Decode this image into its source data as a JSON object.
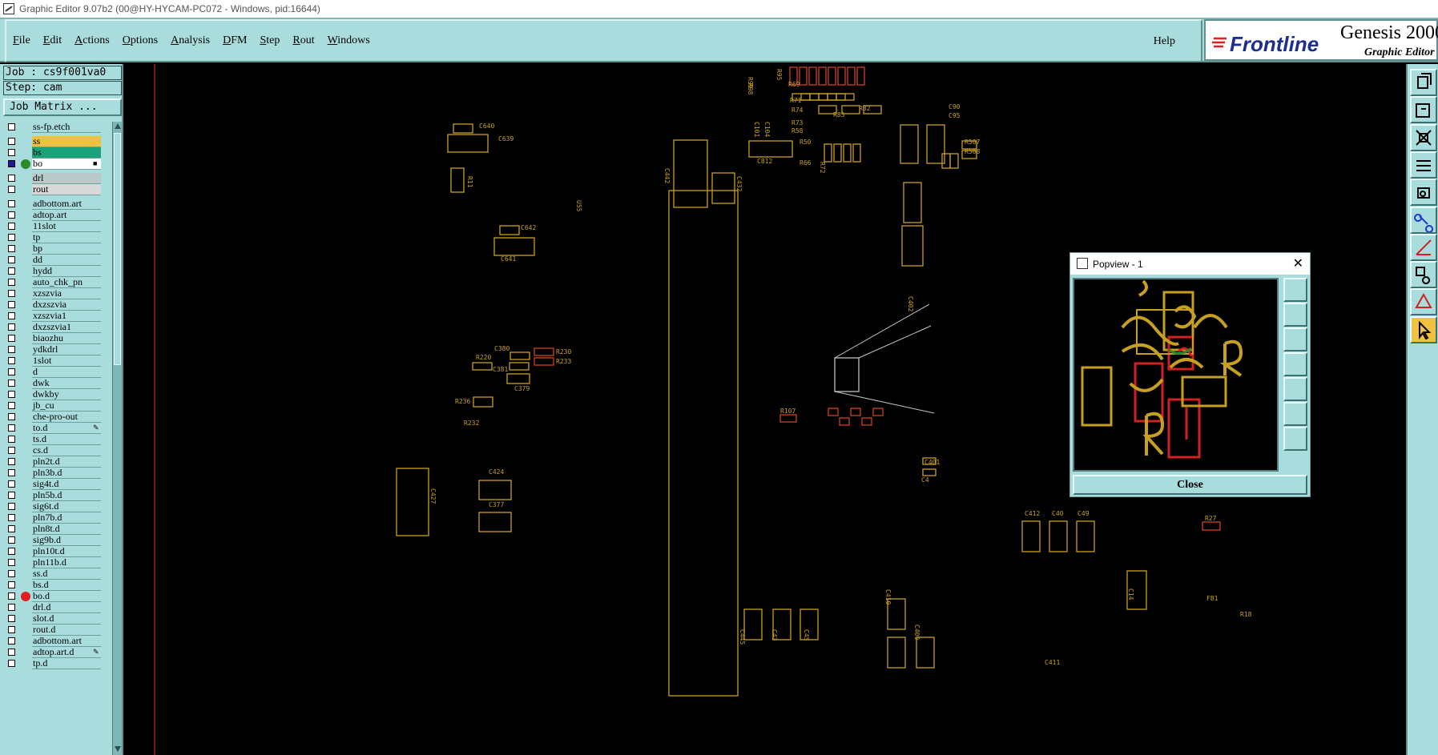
{
  "window": {
    "title": "Graphic Editor 9.07b2 (00@HY-HYCAM-PC072 - Windows, pid:16644)"
  },
  "menubar": {
    "items": [
      "File",
      "Edit",
      "Actions",
      "Options",
      "Analysis",
      "DFM",
      "Step",
      "Rout",
      "Windows"
    ],
    "help": "Help"
  },
  "brand": {
    "logo": "Frontline",
    "product": "Genesis 2000",
    "subtitle": "Graphic Editor"
  },
  "job": {
    "job_label": "Job : cs9f001va0",
    "step_label": "Step: cam",
    "matrix_button": "Job Matrix ..."
  },
  "colors": {
    "panel": "#a9dcdc",
    "layer_ss": "#f0c040",
    "layer_bs": "#1aa37a",
    "trace": "#c8a020",
    "pad_red": "#d04020"
  },
  "layers": [
    {
      "name": "ss-fp.etch",
      "bg": "#a9dcdc",
      "checked": false
    },
    {
      "name": "ss",
      "bg": "#f0c040",
      "checked": false
    },
    {
      "name": "bs",
      "bg": "#1aa37a",
      "checked": false
    },
    {
      "name": "bo",
      "bg": "#ffffff",
      "checked": true,
      "mark": "#2a8a2a",
      "ext": "■"
    },
    {
      "name": "drl",
      "bg": "#b9c9c9",
      "checked": false
    },
    {
      "name": "rout",
      "bg": "#d9d9d9",
      "checked": false
    },
    {
      "name": "adbottom.art",
      "bg": "#a9dcdc",
      "checked": false
    },
    {
      "name": "adtop.art",
      "bg": "#a9dcdc",
      "checked": false
    },
    {
      "name": "11slot",
      "bg": "#a9dcdc",
      "checked": false
    },
    {
      "name": "tp",
      "bg": "#a9dcdc",
      "checked": false
    },
    {
      "name": "bp",
      "bg": "#a9dcdc",
      "checked": false
    },
    {
      "name": "dd",
      "bg": "#a9dcdc",
      "checked": false
    },
    {
      "name": "hydd",
      "bg": "#a9dcdc",
      "checked": false
    },
    {
      "name": "auto_chk_pn",
      "bg": "#a9dcdc",
      "checked": false
    },
    {
      "name": "xzszvia",
      "bg": "#a9dcdc",
      "checked": false
    },
    {
      "name": "dxzszvia",
      "bg": "#a9dcdc",
      "checked": false
    },
    {
      "name": "xzszvia1",
      "bg": "#a9dcdc",
      "checked": false
    },
    {
      "name": "dxzszvia1",
      "bg": "#a9dcdc",
      "checked": false
    },
    {
      "name": "biaozhu",
      "bg": "#a9dcdc",
      "checked": false
    },
    {
      "name": "ydkdrl",
      "bg": "#a9dcdc",
      "checked": false
    },
    {
      "name": "1slot",
      "bg": "#a9dcdc",
      "checked": false
    },
    {
      "name": "d",
      "bg": "#a9dcdc",
      "checked": false
    },
    {
      "name": "dwk",
      "bg": "#a9dcdc",
      "checked": false
    },
    {
      "name": "dwkby",
      "bg": "#a9dcdc",
      "checked": false
    },
    {
      "name": "jb_cu",
      "bg": "#a9dcdc",
      "checked": false
    },
    {
      "name": "che-pro-out",
      "bg": "#a9dcdc",
      "checked": false
    },
    {
      "name": "to.d",
      "bg": "#a9dcdc",
      "checked": false,
      "ext": "✎"
    },
    {
      "name": "ts.d",
      "bg": "#a9dcdc",
      "checked": false
    },
    {
      "name": "cs.d",
      "bg": "#a9dcdc",
      "checked": false
    },
    {
      "name": "pln2t.d",
      "bg": "#a9dcdc",
      "checked": false
    },
    {
      "name": "pln3b.d",
      "bg": "#a9dcdc",
      "checked": false
    },
    {
      "name": "sig4t.d",
      "bg": "#a9dcdc",
      "checked": false
    },
    {
      "name": "pln5b.d",
      "bg": "#a9dcdc",
      "checked": false
    },
    {
      "name": "sig6t.d",
      "bg": "#a9dcdc",
      "checked": false
    },
    {
      "name": "pln7b.d",
      "bg": "#a9dcdc",
      "checked": false
    },
    {
      "name": "pln8t.d",
      "bg": "#a9dcdc",
      "checked": false
    },
    {
      "name": "sig9b.d",
      "bg": "#a9dcdc",
      "checked": false
    },
    {
      "name": "pln10t.d",
      "bg": "#a9dcdc",
      "checked": false
    },
    {
      "name": "pln11b.d",
      "bg": "#a9dcdc",
      "checked": false
    },
    {
      "name": "ss.d",
      "bg": "#a9dcdc",
      "checked": false
    },
    {
      "name": "bs.d",
      "bg": "#a9dcdc",
      "checked": false
    },
    {
      "name": "bo.d",
      "bg": "#a9dcdc",
      "checked": false,
      "mark": "#e02020"
    },
    {
      "name": "drl.d",
      "bg": "#a9dcdc",
      "checked": false
    },
    {
      "name": "slot.d",
      "bg": "#a9dcdc",
      "checked": false
    },
    {
      "name": "rout.d",
      "bg": "#a9dcdc",
      "checked": false
    },
    {
      "name": "adbottom.art",
      "bg": "#a9dcdc",
      "checked": false
    },
    {
      "name": "adtop.art.d",
      "bg": "#a9dcdc",
      "checked": false,
      "ext": "✎"
    },
    {
      "name": "tp.d",
      "bg": "#a9dcdc",
      "checked": false
    }
  ],
  "popview": {
    "title": "Popview - 1",
    "close_label": "Close"
  },
  "righttools": [
    "open-icon",
    "zoom-home-icon",
    "fit-icon",
    "snap-icon",
    "camera-icon",
    "net-icon",
    "measure-icon",
    "select-icon",
    "drc-icon",
    "pointer-icon"
  ],
  "canvas_labels": [
    "C640",
    "C639",
    "R11",
    "C642",
    "C641",
    "U55",
    "C442",
    "C432",
    "C380",
    "R220",
    "R230",
    "R233",
    "C381",
    "C379",
    "R236",
    "R232",
    "C424",
    "C377",
    "C427",
    "C410",
    "C409",
    "C445",
    "C43",
    "C45",
    "C412",
    "C40",
    "C49",
    "C14",
    "R27",
    "FB1",
    "R107",
    "C401",
    "C402",
    "R18",
    "C4",
    "C411",
    "R507",
    "R508",
    "C812",
    "C90",
    "C95",
    "R66",
    "R72",
    "R85",
    "R82",
    "C101",
    "C104",
    "R69",
    "R71",
    "R74",
    "R73",
    "R58",
    "R99",
    "R50",
    "R98",
    "R95"
  ]
}
